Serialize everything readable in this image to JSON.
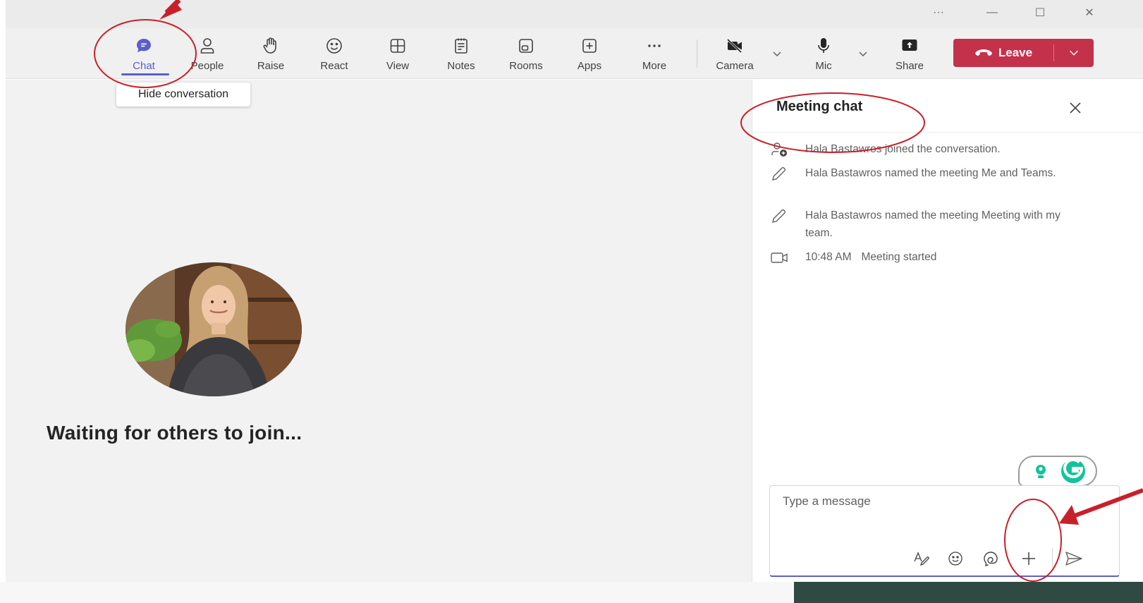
{
  "window": {
    "more_label": "···",
    "minimize_label": "—",
    "maximize_label": "☐",
    "close_label": "✕"
  },
  "toolbar": {
    "items": [
      {
        "label": "Chat",
        "icon": "chat-icon",
        "active": true
      },
      {
        "label": "People",
        "icon": "people-icon"
      },
      {
        "label": "Raise",
        "icon": "raise-hand-icon"
      },
      {
        "label": "React",
        "icon": "react-smiley-icon"
      },
      {
        "label": "View",
        "icon": "view-grid-icon"
      },
      {
        "label": "Notes",
        "icon": "notes-icon"
      },
      {
        "label": "Rooms",
        "icon": "rooms-icon"
      },
      {
        "label": "Apps",
        "icon": "apps-plus-icon"
      },
      {
        "label": "More",
        "icon": "more-dots-icon"
      },
      {
        "label": "Camera",
        "icon": "camera-off-icon"
      },
      {
        "label": "Mic",
        "icon": "mic-icon"
      },
      {
        "label": "Share",
        "icon": "share-icon"
      }
    ],
    "leave_label": "Leave",
    "accent_color": "#5b5fc7",
    "leave_color": "#c4314b"
  },
  "tooltip": {
    "text": "Hide conversation"
  },
  "stage": {
    "waiting_text": "Waiting for others to join..."
  },
  "chat": {
    "title": "Meeting chat",
    "events": [
      {
        "icon": "person-joined-icon",
        "text": "Hala Bastawros joined the conversation."
      },
      {
        "icon": "pencil-icon",
        "text": "Hala Bastawros named the meeting Me and Teams."
      },
      {
        "icon": "pencil-icon",
        "text": "Hala Bastawros named the meeting Meeting with my team."
      },
      {
        "icon": "video-camera-icon",
        "time": "10:48 AM",
        "text": "Meeting started"
      }
    ],
    "compose_placeholder": "Type a message"
  },
  "annotations": {
    "color": "#c8202a"
  }
}
